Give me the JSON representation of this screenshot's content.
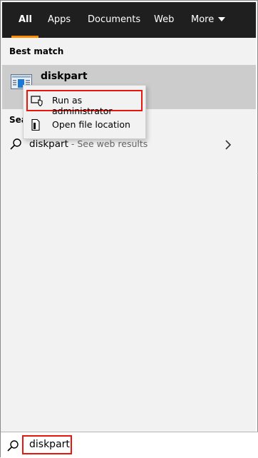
{
  "tabs": [
    {
      "label": "All",
      "active": true
    },
    {
      "label": "Apps",
      "active": false
    },
    {
      "label": "Documents",
      "active": false
    },
    {
      "label": "Web",
      "active": false
    },
    {
      "label": "More",
      "active": false
    }
  ],
  "best_match": {
    "header": "Best match",
    "app_name": "diskpart",
    "icon": "disk-management-app-icon"
  },
  "search_web": {
    "header": "Sea",
    "term": "diskpart",
    "suffix": " - See web results",
    "icon": "magnifier-icon"
  },
  "context_menu": {
    "items": [
      {
        "label": "Run as administrator",
        "icon": "shield-admin-icon"
      },
      {
        "label": "Open file location",
        "icon": "file-icon"
      }
    ]
  },
  "search_bar": {
    "value": "diskpart",
    "icon": "magnifier-icon"
  },
  "colors": {
    "tabbar_bg": "#1f1f1f",
    "accent": "#ff8c00",
    "highlight_outline": "#e8160c",
    "selected_row_bg": "#cccccc",
    "panel_bg": "#f2f2f2"
  }
}
